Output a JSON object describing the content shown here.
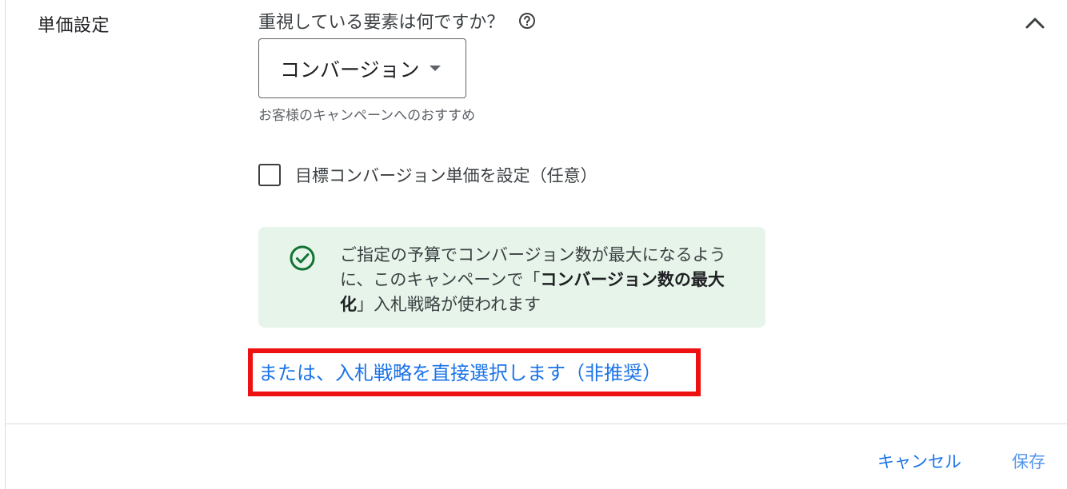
{
  "section": {
    "label": "単価設定"
  },
  "question": {
    "text": "重視している要素は何ですか？"
  },
  "dropdown": {
    "selected": "コンバージョン"
  },
  "recommendation": {
    "text": "お客様のキャンペーンへのおすすめ"
  },
  "checkbox": {
    "label": "目標コンバージョン単価を設定（任意）",
    "checked": false
  },
  "info": {
    "text_before": "ご指定の予算でコンバージョン数が最大になるように、このキャンペーンで「",
    "text_bold": "コンバージョン数の最大化",
    "text_after": "」入札戦略が使われます"
  },
  "link": {
    "text": "または、入札戦略を直接選択します（非推奨）"
  },
  "footer": {
    "cancel_label": "キャンセル",
    "save_label": "保存"
  },
  "colors": {
    "accent": "#1a73e8",
    "info_bg": "#e6f4ea",
    "success_icon": "#137333",
    "highlight": "#ee1111"
  },
  "icons": {
    "help": "help-circle-icon",
    "collapse": "chevron-up-icon",
    "caret": "caret-down-icon",
    "check": "check-circle-icon"
  }
}
